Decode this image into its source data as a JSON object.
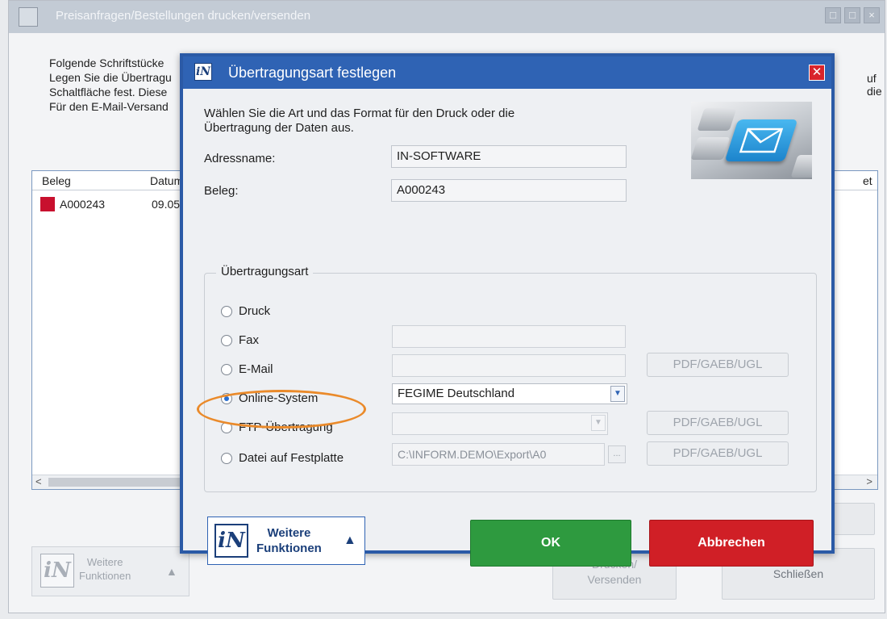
{
  "background_window": {
    "title": "Preisanfragen/Bestellungen drucken/versenden",
    "window_buttons": [
      "□",
      "□",
      "×"
    ],
    "intro_lines": [
      "Folgende Schriftstücke",
      "Legen Sie die Übertragu",
      "Schaltfläche fest. Diese",
      "Für den E-Mail-Versand"
    ],
    "intro_right_fragment": "uf die",
    "table": {
      "headers": [
        "Beleg",
        "Datum",
        "et"
      ],
      "row": {
        "beleg": "A000243",
        "datum": "09.05"
      }
    },
    "scroll_left": "<",
    "scroll_right": ">",
    "weitere_label_line1": "Weitere",
    "weitere_label_line2": "Funktionen",
    "weitere_arrow": "▲",
    "drucken_line1": "Drucken/",
    "drucken_line2": "Versenden",
    "schliessen": "Schließen"
  },
  "dialog": {
    "title": "Übertragungsart festlegen",
    "close_glyph": "✕",
    "description_line1": "Wählen Sie die Art und das Format für den Druck oder die",
    "description_line2": "Übertragung der Daten aus.",
    "address_label": "Adressname:",
    "address_value": "IN-SOFTWARE",
    "beleg_label": "Beleg:",
    "beleg_value": "A000243",
    "group_legend": "Übertragungsart",
    "options": {
      "druck": "Druck",
      "fax": "Fax",
      "email": "E-Mail",
      "online": "Online-System",
      "ftp": "FTP-Übertragung",
      "datei": "Datei auf Festplatte"
    },
    "selected_option": "Online-System",
    "online_system_value": "FEGIME Deutschland",
    "file_path_value": "C:\\INFORM.DEMO\\Export\\A0",
    "browse_label": "...",
    "pdf_button_label": "PDF/GAEB/UGL",
    "weitere_line1": "Weitere",
    "weitere_line2": "Funktionen",
    "weitere_arrow": "▲",
    "ok_label": "OK",
    "cancel_label": "Abbrechen",
    "select_arrow_glyph": "▼",
    "colors": {
      "title_bar": "#2f63b4",
      "ok": "#2e9a3f",
      "cancel": "#d01f26",
      "highlight": "#ea8a2a"
    }
  }
}
